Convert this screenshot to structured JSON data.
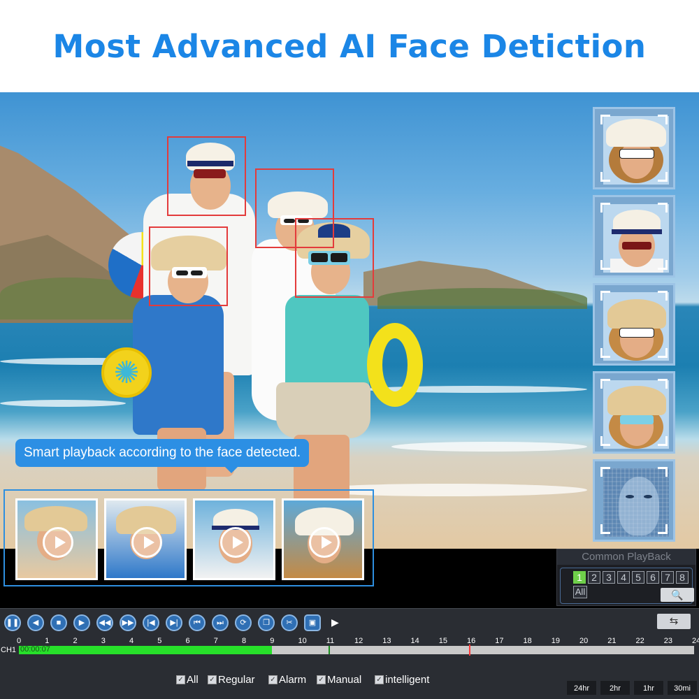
{
  "headline": "Most Advanced AI Face Detiction",
  "callout": "Smart playback according to the face detected.",
  "common_playback": {
    "title": "Common PlayBack",
    "channels": [
      "1",
      "2",
      "3",
      "4",
      "5",
      "6",
      "7",
      "8"
    ],
    "active_channel": "1",
    "all_label": "All",
    "search_icon": "search-icon"
  },
  "toolbar": {
    "buttons": [
      {
        "name": "pause",
        "icon": "pause-icon",
        "glyph": "❚❚"
      },
      {
        "name": "reverse",
        "icon": "reverse-play-icon",
        "glyph": "◀"
      },
      {
        "name": "stop",
        "icon": "stop-icon",
        "glyph": "■"
      },
      {
        "name": "play",
        "icon": "play-icon",
        "glyph": "▶"
      },
      {
        "name": "slow",
        "icon": "slow-icon",
        "glyph": "◀◀"
      },
      {
        "name": "fast",
        "icon": "fast-forward-icon",
        "glyph": "▶▶"
      },
      {
        "name": "prev-frame",
        "icon": "previous-frame-icon",
        "glyph": "|◀"
      },
      {
        "name": "next-frame",
        "icon": "next-frame-icon",
        "glyph": "▶|"
      },
      {
        "name": "prev-file",
        "icon": "previous-file-icon",
        "glyph": "⏮"
      },
      {
        "name": "next-file",
        "icon": "next-file-icon",
        "glyph": "⏭"
      },
      {
        "name": "loop",
        "icon": "loop-icon",
        "glyph": "⟳"
      },
      {
        "name": "copy",
        "icon": "copy-icon",
        "glyph": "❐"
      },
      {
        "name": "clip",
        "icon": "scissors-icon",
        "glyph": "✂"
      },
      {
        "name": "save",
        "icon": "save-icon",
        "glyph": "▣"
      }
    ],
    "more_icon": "expand-arrow-icon",
    "sync_icon": "sync-icon"
  },
  "timeline": {
    "channel": "CH1",
    "time": "00:00:07",
    "hours": [
      "0",
      "1",
      "2",
      "3",
      "4",
      "5",
      "6",
      "7",
      "8",
      "9",
      "10",
      "11",
      "12",
      "13",
      "14",
      "15",
      "16",
      "17",
      "18",
      "19",
      "20",
      "21",
      "22",
      "23",
      "24"
    ],
    "recorded_until_hour": 9,
    "extra_mark_hour": 11,
    "cursor_hour": 16
  },
  "filters": [
    {
      "label": "All",
      "checked": true
    },
    {
      "label": "Regular",
      "checked": true
    },
    {
      "label": "Alarm",
      "checked": true
    },
    {
      "label": "Manual",
      "checked": true
    },
    {
      "label": "intelligent",
      "checked": true
    }
  ],
  "zoom_levels": [
    "24hr",
    "2hr",
    "1hr",
    "30mi"
  ],
  "colors": {
    "headline": "#1b86e6",
    "face_box": "#e33b3b",
    "record_green": "#27e02a",
    "accent_blue": "#2c8fe4"
  }
}
